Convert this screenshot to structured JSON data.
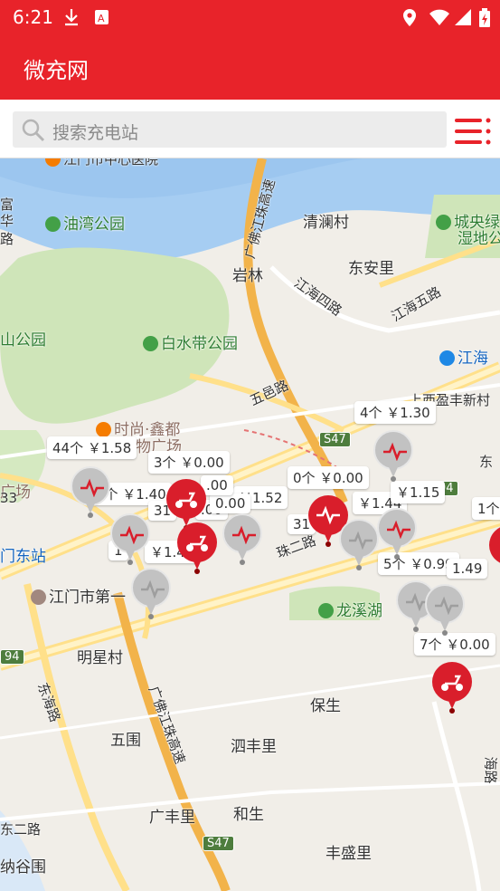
{
  "status_bar": {
    "time": "6:21"
  },
  "app_bar": {
    "title": "微充网"
  },
  "search": {
    "placeholder": "搜索充电站"
  },
  "map": {
    "labels": [
      {
        "key": "hosp",
        "text": "江门市中心医院"
      },
      {
        "key": "park1",
        "text": "油湾公园"
      },
      {
        "key": "qinglan",
        "text": "清澜村"
      },
      {
        "key": "cheng",
        "text": "城央绿"
      },
      {
        "key": "shidi",
        "text": "湿地公"
      },
      {
        "key": "yanlin",
        "text": "岩林"
      },
      {
        "key": "dongan",
        "text": "东安里"
      },
      {
        "key": "jhsi",
        "text": "江海四路"
      },
      {
        "key": "jhwu",
        "text": "江海五路"
      },
      {
        "key": "shan",
        "text": "山公园"
      },
      {
        "key": "baishui",
        "text": "白水带公园"
      },
      {
        "key": "jianghai",
        "text": "江海"
      },
      {
        "key": "wuyi",
        "text": "五邑路"
      },
      {
        "key": "shang",
        "text": "上西盈丰新村"
      },
      {
        "key": "shishang",
        "text": "时尚·鑫都"
      },
      {
        "key": "wuguang",
        "text": "物广场"
      },
      {
        "key": "guangchang",
        "text": "广场"
      },
      {
        "key": "dongzhan",
        "text": "门东站"
      },
      {
        "key": "jiangmen1",
        "text": "江门市第一"
      },
      {
        "key": "longxi",
        "text": "龙溪湖"
      },
      {
        "key": "mingxing",
        "text": "明星村"
      },
      {
        "key": "zhuer",
        "text": "珠二路"
      },
      {
        "key": "donghai",
        "text": "东海路"
      },
      {
        "key": "guangfo",
        "text": "广佛江珠高速"
      },
      {
        "key": "guangfo2",
        "text": "广佛江珠高速"
      },
      {
        "key": "baosheng",
        "text": "保生"
      },
      {
        "key": "wuwei",
        "text": "五围"
      },
      {
        "key": "sifeng",
        "text": "泗丰里"
      },
      {
        "key": "guangfeng",
        "text": "广丰里"
      },
      {
        "key": "hesheng",
        "text": "和生"
      },
      {
        "key": "fengsheng",
        "text": "丰盛里"
      },
      {
        "key": "dongerlu",
        "text": "东二路"
      },
      {
        "key": "nagu",
        "text": "纳谷围"
      },
      {
        "key": "hai",
        "text": "海路"
      },
      {
        "key": "fu",
        "text": "富"
      },
      {
        "key": "hua",
        "text": "华"
      },
      {
        "key": "lu",
        "text": "路"
      },
      {
        "key": "n133",
        "text": "33"
      },
      {
        "key": "dong",
        "text": "东"
      }
    ],
    "highways": [
      "S47",
      "S47",
      "94",
      "94"
    ],
    "stations": [
      {
        "bubble": "4个 ￥1.30",
        "color": "gray"
      },
      {
        "bubble": "44个 ￥1.58",
        "color": "gray"
      },
      {
        "bubble": "3个 ￥0.00",
        "color": "red"
      },
      {
        "bubble": "4个 ￥1.40",
        "color": "gray"
      },
      {
        "bubble": "￥1.52",
        "color": "gray"
      },
      {
        "bubble": "0个 ￥0.00",
        "color": "red"
      },
      {
        "bubble": "￥1.44",
        "color": "gray"
      },
      {
        "bubble": "￥1.15",
        "color": "gray"
      },
      {
        "bubble": "1个",
        "color": "red"
      },
      {
        "bubble": "￥1.45",
        "color": "gray"
      },
      {
        "bubble": "5个 ￥0.99",
        "color": "gray"
      },
      {
        "bubble": "1.49",
        "color": "gray"
      },
      {
        "bubble": "7个 ￥0.00",
        "color": "red"
      },
      {
        "bubble": "31",
        "color": "red"
      },
      {
        "bubble": "31",
        "color": "gray"
      },
      {
        "bubble": ".00",
        "color": "red"
      },
      {
        "bubble": "0.00",
        "color": "gray"
      },
      {
        "bubble": ".00",
        "color": "red"
      },
      {
        "bubble": "1",
        "color": "gray"
      }
    ]
  },
  "colors": {
    "brand": "#e8232a",
    "water": "#a6cdf2",
    "green": "#cfe5b9",
    "road": "#ffe08a",
    "highway": "#f2b34a"
  }
}
